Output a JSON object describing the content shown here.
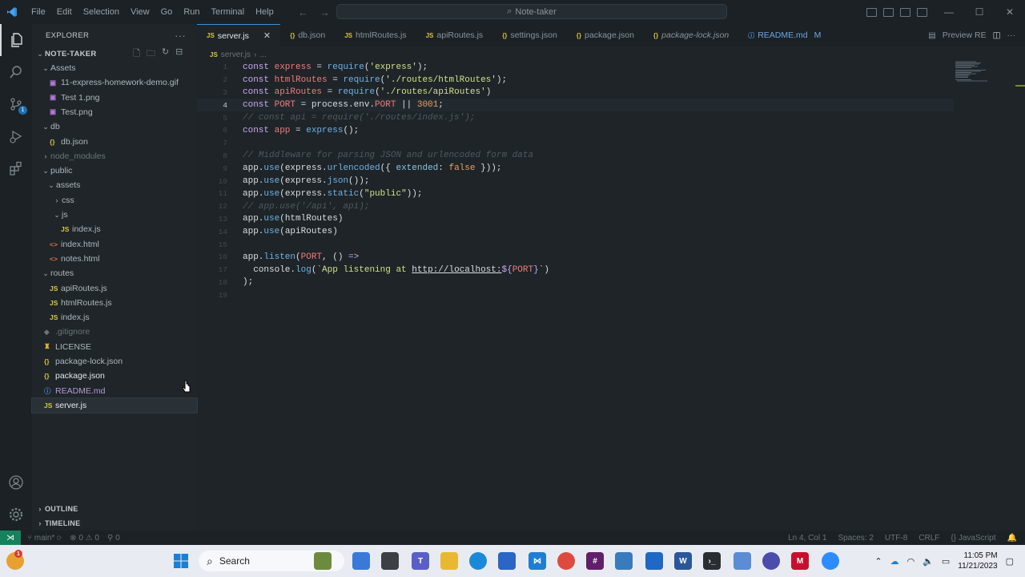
{
  "titlebar": {
    "menu": [
      "File",
      "Edit",
      "Selection",
      "View",
      "Go",
      "Run",
      "Terminal",
      "Help"
    ],
    "search_text": "Note-taker"
  },
  "sidebar": {
    "header": "EXPLORER",
    "project": "NOTE-TAKER",
    "tree": [
      {
        "label": "Assets",
        "indent": 1,
        "type": "folder-open",
        "icon": ""
      },
      {
        "label": "11-express-homework-demo.gif",
        "indent": 2,
        "type": "file",
        "icon": "img"
      },
      {
        "label": "Test 1.png",
        "indent": 2,
        "type": "file",
        "icon": "img"
      },
      {
        "label": "Test.png",
        "indent": 2,
        "type": "file",
        "icon": "img"
      },
      {
        "label": "db",
        "indent": 1,
        "type": "folder-open",
        "icon": ""
      },
      {
        "label": "db.json",
        "indent": 2,
        "type": "file",
        "icon": "json"
      },
      {
        "label": "node_modules",
        "indent": 1,
        "type": "folder-closed",
        "icon": "",
        "dim": true
      },
      {
        "label": "public",
        "indent": 1,
        "type": "folder-open",
        "icon": ""
      },
      {
        "label": "assets",
        "indent": 2,
        "type": "folder-open",
        "icon": ""
      },
      {
        "label": "css",
        "indent": 3,
        "type": "folder-closed",
        "icon": ""
      },
      {
        "label": "js",
        "indent": 3,
        "type": "folder-open",
        "icon": ""
      },
      {
        "label": "index.js",
        "indent": 4,
        "type": "file",
        "icon": "js"
      },
      {
        "label": "index.html",
        "indent": 2,
        "type": "file",
        "icon": "html"
      },
      {
        "label": "notes.html",
        "indent": 2,
        "type": "file",
        "icon": "html"
      },
      {
        "label": "routes",
        "indent": 1,
        "type": "folder-open",
        "icon": ""
      },
      {
        "label": "apiRoutes.js",
        "indent": 2,
        "type": "file",
        "icon": "js"
      },
      {
        "label": "htmlRoutes.js",
        "indent": 2,
        "type": "file",
        "icon": "js"
      },
      {
        "label": "index.js",
        "indent": 2,
        "type": "file",
        "icon": "js"
      },
      {
        "label": ".gitignore",
        "indent": 1,
        "type": "file",
        "icon": "git",
        "dim": true
      },
      {
        "label": "LICENSE",
        "indent": 1,
        "type": "file",
        "icon": "lic"
      },
      {
        "label": "package-lock.json",
        "indent": 1,
        "type": "file",
        "icon": "json"
      },
      {
        "label": "package.json",
        "indent": 1,
        "type": "file",
        "icon": "json",
        "bright": true
      },
      {
        "label": "README.md",
        "indent": 1,
        "type": "file",
        "icon": "md",
        "purple": true
      },
      {
        "label": "server.js",
        "indent": 1,
        "type": "file",
        "icon": "js",
        "selected": true
      }
    ],
    "outline": "OUTLINE",
    "timeline": "TIMELINE"
  },
  "tabs": [
    {
      "label": "server.js",
      "icon": "JS",
      "active": true
    },
    {
      "label": "db.json",
      "icon": "{}"
    },
    {
      "label": "htmlRoutes.js",
      "icon": "JS"
    },
    {
      "label": "apiRoutes.js",
      "icon": "JS"
    },
    {
      "label": "settings.json",
      "icon": "{}"
    },
    {
      "label": "package.json",
      "icon": "{}"
    },
    {
      "label": "package-lock.json",
      "icon": "{}",
      "italic": true
    },
    {
      "label": "README.md",
      "icon": "i",
      "modified": "M"
    }
  ],
  "preview_tab": "Preview RE",
  "breadcrumb": {
    "file": "server.js",
    "rest": "..."
  },
  "editor": {
    "current_line": 4,
    "lines": [
      [
        [
          "kw",
          "const "
        ],
        [
          "var",
          "express"
        ],
        [
          "plain",
          " = "
        ],
        [
          "fn",
          "require"
        ],
        [
          "plain",
          "("
        ],
        [
          "str",
          "'express'"
        ],
        [
          "plain",
          ");"
        ]
      ],
      [
        [
          "kw",
          "const "
        ],
        [
          "var",
          "htmlRoutes"
        ],
        [
          "plain",
          " = "
        ],
        [
          "fn",
          "require"
        ],
        [
          "plain",
          "("
        ],
        [
          "str",
          "'./routes/htmlRoutes'"
        ],
        [
          "plain",
          ");"
        ]
      ],
      [
        [
          "kw",
          "const "
        ],
        [
          "var",
          "apiRoutes"
        ],
        [
          "plain",
          " = "
        ],
        [
          "fn",
          "require"
        ],
        [
          "plain",
          "("
        ],
        [
          "str",
          "'./routes/apiRoutes'"
        ],
        [
          "plain",
          ")"
        ]
      ],
      [
        [
          "kw",
          "const "
        ],
        [
          "var",
          "PORT"
        ],
        [
          "plain",
          " = process.env."
        ],
        [
          "var",
          "PORT"
        ],
        [
          "plain",
          " || "
        ],
        [
          "num",
          "3001"
        ],
        [
          "plain",
          ";"
        ]
      ],
      [
        [
          "com",
          "// const api = require('./routes/index.js');"
        ]
      ],
      [
        [
          "kw",
          "const "
        ],
        [
          "var",
          "app"
        ],
        [
          "plain",
          " = "
        ],
        [
          "fn",
          "express"
        ],
        [
          "plain",
          "();"
        ]
      ],
      [],
      [
        [
          "com",
          "// Middleware for parsing JSON and urlencoded form data"
        ]
      ],
      [
        [
          "plain",
          "app."
        ],
        [
          "fn",
          "use"
        ],
        [
          "plain",
          "(express."
        ],
        [
          "fn",
          "urlencoded"
        ],
        [
          "plain",
          "({ "
        ],
        [
          "prop",
          "extended"
        ],
        [
          "plain",
          ": "
        ],
        [
          "num",
          "false"
        ],
        [
          "plain",
          " }));"
        ]
      ],
      [
        [
          "plain",
          "app."
        ],
        [
          "fn",
          "use"
        ],
        [
          "plain",
          "(express."
        ],
        [
          "fn",
          "json"
        ],
        [
          "plain",
          "());"
        ]
      ],
      [
        [
          "plain",
          "app."
        ],
        [
          "fn",
          "use"
        ],
        [
          "plain",
          "(express."
        ],
        [
          "fn",
          "static"
        ],
        [
          "plain",
          "("
        ],
        [
          "str",
          "\"public\""
        ],
        [
          "plain",
          "));"
        ]
      ],
      [
        [
          "com",
          "// app.use('/api', api);"
        ]
      ],
      [
        [
          "plain",
          "app."
        ],
        [
          "fn",
          "use"
        ],
        [
          "plain",
          "(htmlRoutes)"
        ]
      ],
      [
        [
          "plain",
          "app."
        ],
        [
          "fn",
          "use"
        ],
        [
          "plain",
          "(apiRoutes)"
        ]
      ],
      [],
      [
        [
          "plain",
          "app."
        ],
        [
          "fn",
          "listen"
        ],
        [
          "plain",
          "("
        ],
        [
          "var",
          "PORT"
        ],
        [
          "plain",
          ", () "
        ],
        [
          "kw",
          "=>"
        ]
      ],
      [
        [
          "plain",
          "  console."
        ],
        [
          "fn",
          "log"
        ],
        [
          "plain",
          "("
        ],
        [
          "str",
          "`App listening at "
        ],
        [
          "link",
          "http://localhost:"
        ],
        [
          "kw",
          "${"
        ],
        [
          "var",
          "PORT"
        ],
        [
          "kw",
          "}"
        ],
        [
          "str",
          "`"
        ],
        [
          "plain",
          ")"
        ]
      ],
      [
        [
          "plain",
          ");"
        ]
      ],
      []
    ]
  },
  "statusbar": {
    "branch": "main*",
    "errors": "0",
    "warnings": "0",
    "ports": "0",
    "position": "Ln 4, Col 1",
    "spaces": "Spaces: 2",
    "encoding": "UTF-8",
    "eol": "CRLF",
    "language": "JavaScript"
  },
  "taskbar": {
    "search": "Search",
    "time": "11:05 PM",
    "date": "11/21/2023",
    "notification_count": "1"
  },
  "colors": {
    "accent": "#3e8fd5",
    "remote": "#16825d"
  }
}
